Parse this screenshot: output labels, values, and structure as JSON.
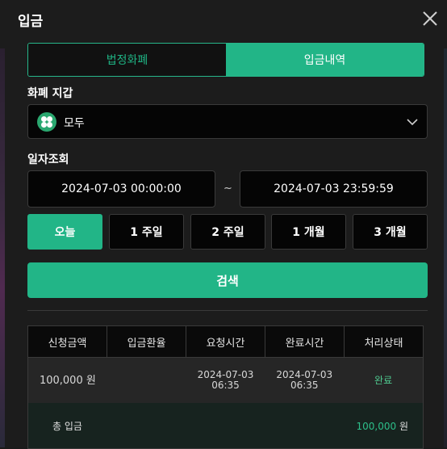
{
  "modal": {
    "title": "입금",
    "tabs": [
      {
        "label": "법정화폐",
        "active": false
      },
      {
        "label": "입금내역",
        "active": true
      }
    ],
    "wallet": {
      "label": "화폐 지갑",
      "selected": "모두"
    },
    "date_range": {
      "label": "일자조회",
      "start": "2024-07-03 00:00:00",
      "separator": "~",
      "end": "2024-07-03 23:59:59"
    },
    "periods": [
      {
        "label": "오늘",
        "active": true
      },
      {
        "label": "1 주일",
        "active": false
      },
      {
        "label": "2 주일",
        "active": false
      },
      {
        "label": "1 개월",
        "active": false
      },
      {
        "label": "3 개월",
        "active": false
      }
    ],
    "search_label": "검색",
    "table": {
      "headers": [
        "신청금액",
        "입금환율",
        "요청시간",
        "완료시간",
        "처리상태"
      ],
      "rows": [
        {
          "amount": "100,000 원",
          "rate": "",
          "requested_date": "2024-07-03",
          "requested_time": "06:35",
          "completed_date": "2024-07-03",
          "completed_time": "06:35",
          "status": "완료"
        }
      ],
      "footer": {
        "label": "총 입금",
        "total": "100,000",
        "unit": "원"
      }
    }
  },
  "colors": {
    "accent": "#22b587",
    "status_done": "#4fc98f",
    "background": "#1c1c1c"
  },
  "icons": {
    "close": "close-icon",
    "wallet": "wallet-grid-icon",
    "dropdown": "chevron-down-icon"
  }
}
